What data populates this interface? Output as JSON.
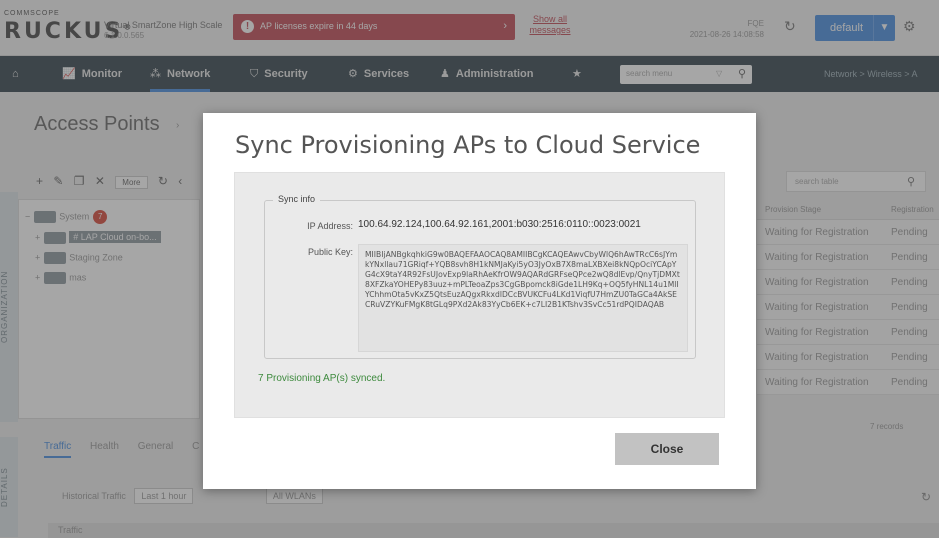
{
  "header": {
    "logo_top": "COMMSCOPE",
    "logo_main": "RUCKUS",
    "logo_tm": "®",
    "product_name": "Virtual SmartZone High Scale",
    "product_version": "6.1.0.0.565",
    "alert_text": "AP licenses expire in 44 days",
    "alert_icon": "info-icon",
    "show_all_line1": "Show all",
    "show_all_line2": "messages",
    "system_name": "FQE",
    "system_datetime": "2021-08-26 14:08:58",
    "domain_selector": "default",
    "colors": {
      "alert": "#c24b56",
      "accent": "#4a8fe0",
      "nav_bg": "#36464f"
    }
  },
  "nav": {
    "items": [
      {
        "label": "",
        "icon": "home-icon"
      },
      {
        "label": "Monitor",
        "icon": "chart-icon"
      },
      {
        "label": "Network",
        "icon": "network-icon"
      },
      {
        "label": "Security",
        "icon": "shield-icon"
      },
      {
        "label": "Services",
        "icon": "gears-icon"
      },
      {
        "label": "Administration",
        "icon": "user-icon"
      },
      {
        "label": "",
        "icon": "star-icon"
      }
    ],
    "search_placeholder": "search menu",
    "breadcrumb": "Network  >  Wireless  >  A"
  },
  "page": {
    "title": "Access Points",
    "toolbar_more": "More",
    "table_search_placeholder": "search table",
    "side_tab_org": "ORGANIZATION",
    "side_tab_details": "DETAILS",
    "tree": [
      {
        "label": "System",
        "badge": "7"
      },
      {
        "label": "# LAP Cloud on-bo..."
      },
      {
        "label": "Staging Zone"
      },
      {
        "label": "mas"
      }
    ],
    "columns": [
      "Provision Stage",
      "Registration"
    ],
    "rows": [
      {
        "stage": "Waiting for Registration",
        "reg": "Pending"
      },
      {
        "stage": "Waiting for Registration",
        "reg": "Pending"
      },
      {
        "stage": "Waiting for Registration",
        "reg": "Pending"
      },
      {
        "stage": "Waiting for Registration",
        "reg": "Pending"
      },
      {
        "stage": "Waiting for Registration",
        "reg": "Pending"
      },
      {
        "stage": "Waiting for Registration",
        "reg": "Pending"
      },
      {
        "stage": "Waiting for Registration",
        "reg": "Pending"
      }
    ],
    "records": "7 records",
    "detail_tabs": [
      "Traffic",
      "Health",
      "General",
      "C"
    ],
    "historical_label": "Historical Traffic",
    "historical_range": "Last 1 hour",
    "wlan_filter": "All WLANs",
    "traffic_section": "Traffic"
  },
  "modal": {
    "title": "Sync Provisioning APs to Cloud Service",
    "section_legend": "Sync info",
    "ip_label": "IP Address:",
    "ip_value": "100.64.92.124,100.64.92.161,2001:b030:2516:0110::0023:0021",
    "key_label": "Public Key:",
    "key_value": "MIIBIjANBgkqhkiG9w0BAQEFAAOCAQ8AMIIBCgKCAQEAwvCbyWlQ6hAwTRcC6sJYmkYNxllau71GRiqf+YQB8svh8H1kNMJaKyi5yO3JyOxB7X8maLXBXei8kNQpOciYCApYG4cX9taY4R92FsUJovExp9laRhAeKfrOW9AQARdGRFseQPce2wQ8dlEvp/QnyTjDMXt8XFZkaYOHEPy83uuz+mPLTeoaZps3CgGBpomck8iGde1LH9Kq+OQ5fyHNL14u1MlIYChhmOta5vKxZ5QtsEuzAQgxRkxdlDCcBVUKCFu4LKd1ViqfU7HmZU0TaGCa4AkSECRuVZYKuFMgK8tGLq9PXd2Ak83YyCb6EK+c7LI2B1KTshv3SvCc51rdPQIDAQAB",
    "status": "7 Provisioning AP(s) synced.",
    "close_label": "Close"
  }
}
